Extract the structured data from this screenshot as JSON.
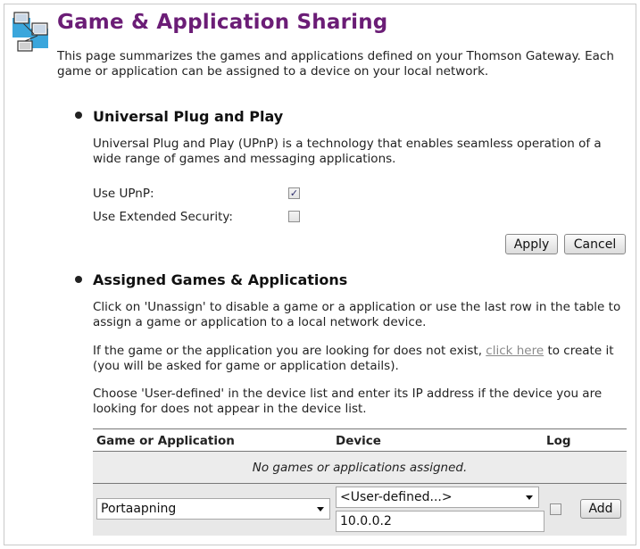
{
  "header": {
    "title": "Game & Application Sharing",
    "intro": "This page summarizes the games and applications defined on your Thomson Gateway. Each game or application can be assigned to a device on your local network."
  },
  "upnp": {
    "title": "Universal Plug and Play",
    "description": "Universal Plug and Play (UPnP) is a technology that enables seamless operation of a wide range of games and messaging applications.",
    "use_upnp_label": "Use UPnP:",
    "use_upnp_checked": true,
    "use_extended_security_label": "Use Extended Security:",
    "use_extended_security_checked": false,
    "apply_label": "Apply",
    "cancel_label": "Cancel"
  },
  "assigned": {
    "title": "Assigned Games & Applications",
    "para1": "Click on 'Unassign' to disable a game or a application or use the last row in the table to assign a game or application to a local network device.",
    "para2_before": "If the game or the application you are looking for does not exist, ",
    "para2_link": "click here",
    "para2_after": " to create it (you will be asked for game or application details).",
    "para3": "Choose 'User-defined' in the device list and enter its IP address if the device you are looking for does not appear in the device list.",
    "table": {
      "columns": [
        "Game or Application",
        "Device",
        "Log"
      ],
      "empty_message": "No games or applications assigned.",
      "new_row": {
        "application_selected": "Portaapning",
        "device_selected": "<User-defined...>",
        "ip_value": "10.0.0.2",
        "log_checked": false,
        "add_label": "Add"
      }
    }
  }
}
